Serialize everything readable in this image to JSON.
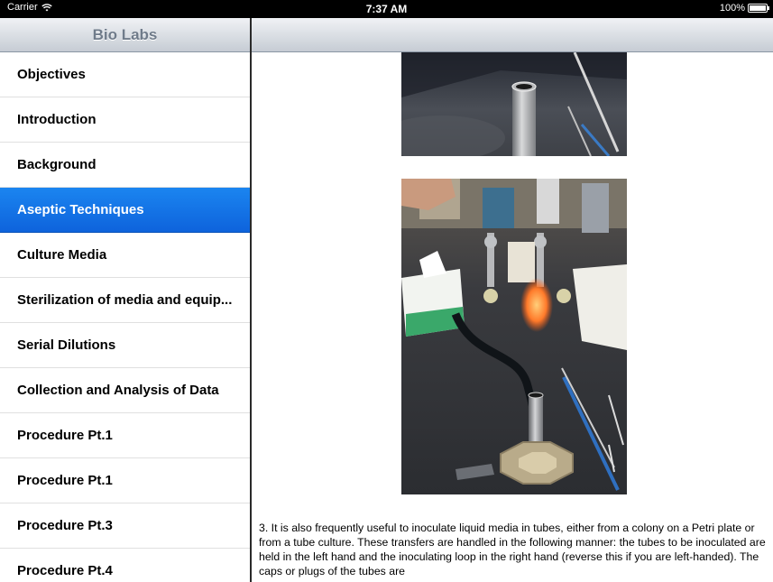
{
  "status_bar": {
    "carrier": "Carrier",
    "time": "7:37 AM",
    "battery": "100%"
  },
  "master": {
    "title": "Bio Labs",
    "selected_index": 3,
    "items": [
      {
        "label": "Objectives"
      },
      {
        "label": "Introduction"
      },
      {
        "label": "Background"
      },
      {
        "label": "Aseptic Techniques"
      },
      {
        "label": "Culture Media"
      },
      {
        "label": "Sterilization of media and equip..."
      },
      {
        "label": "Serial Dilutions"
      },
      {
        "label": "Collection and Analysis of Data"
      },
      {
        "label": "Procedure Pt.1"
      },
      {
        "label": "Procedure Pt.1"
      },
      {
        "label": "Procedure Pt.3"
      },
      {
        "label": "Procedure Pt.4"
      }
    ]
  },
  "detail": {
    "paragraph": "3. It is also frequently useful to inoculate liquid media in tubes, either from a colony on a Petri plate or from a tube culture. These transfers are handled in the following manner: the tubes to be inoculated are held in the left hand and the inoculating loop in the right hand (reverse this if you are left-handed). The caps or plugs of the tubes are"
  },
  "colors": {
    "selection": "#1b85f0",
    "nav_title": "#6f7b8a",
    "status_bar": "#000000"
  }
}
